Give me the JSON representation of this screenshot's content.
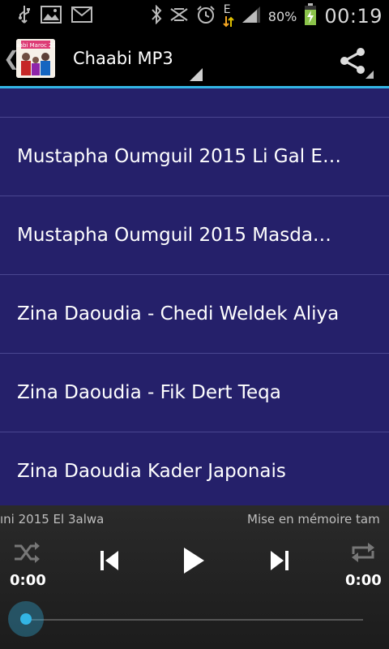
{
  "status_bar": {
    "battery_percent": "80%",
    "time": "00:19",
    "network_type": "E"
  },
  "action_bar": {
    "app_icon_text": "Chaabi Maroc 2015",
    "title": "Chaabi MP3"
  },
  "list": {
    "items": [
      {
        "label": "Mustapha Oumguil 2015 Li Gal E…"
      },
      {
        "label": "Mustapha Oumguil 2015 Masda…"
      },
      {
        "label": "Zina Daoudia - Chedi Weldek Aliya"
      },
      {
        "label": "Zina Daoudia - Fik Dert Teqa"
      },
      {
        "label": "Zina Daoudia Kader Japonais"
      }
    ]
  },
  "player": {
    "track_title": "ıni 2015 El 3alwa",
    "status_text": "Mise en mémoire tam",
    "elapsed": "0:00",
    "duration": "0:00",
    "progress": 0
  },
  "colors": {
    "list_background": "#25206a",
    "accent": "#33b5e5"
  }
}
